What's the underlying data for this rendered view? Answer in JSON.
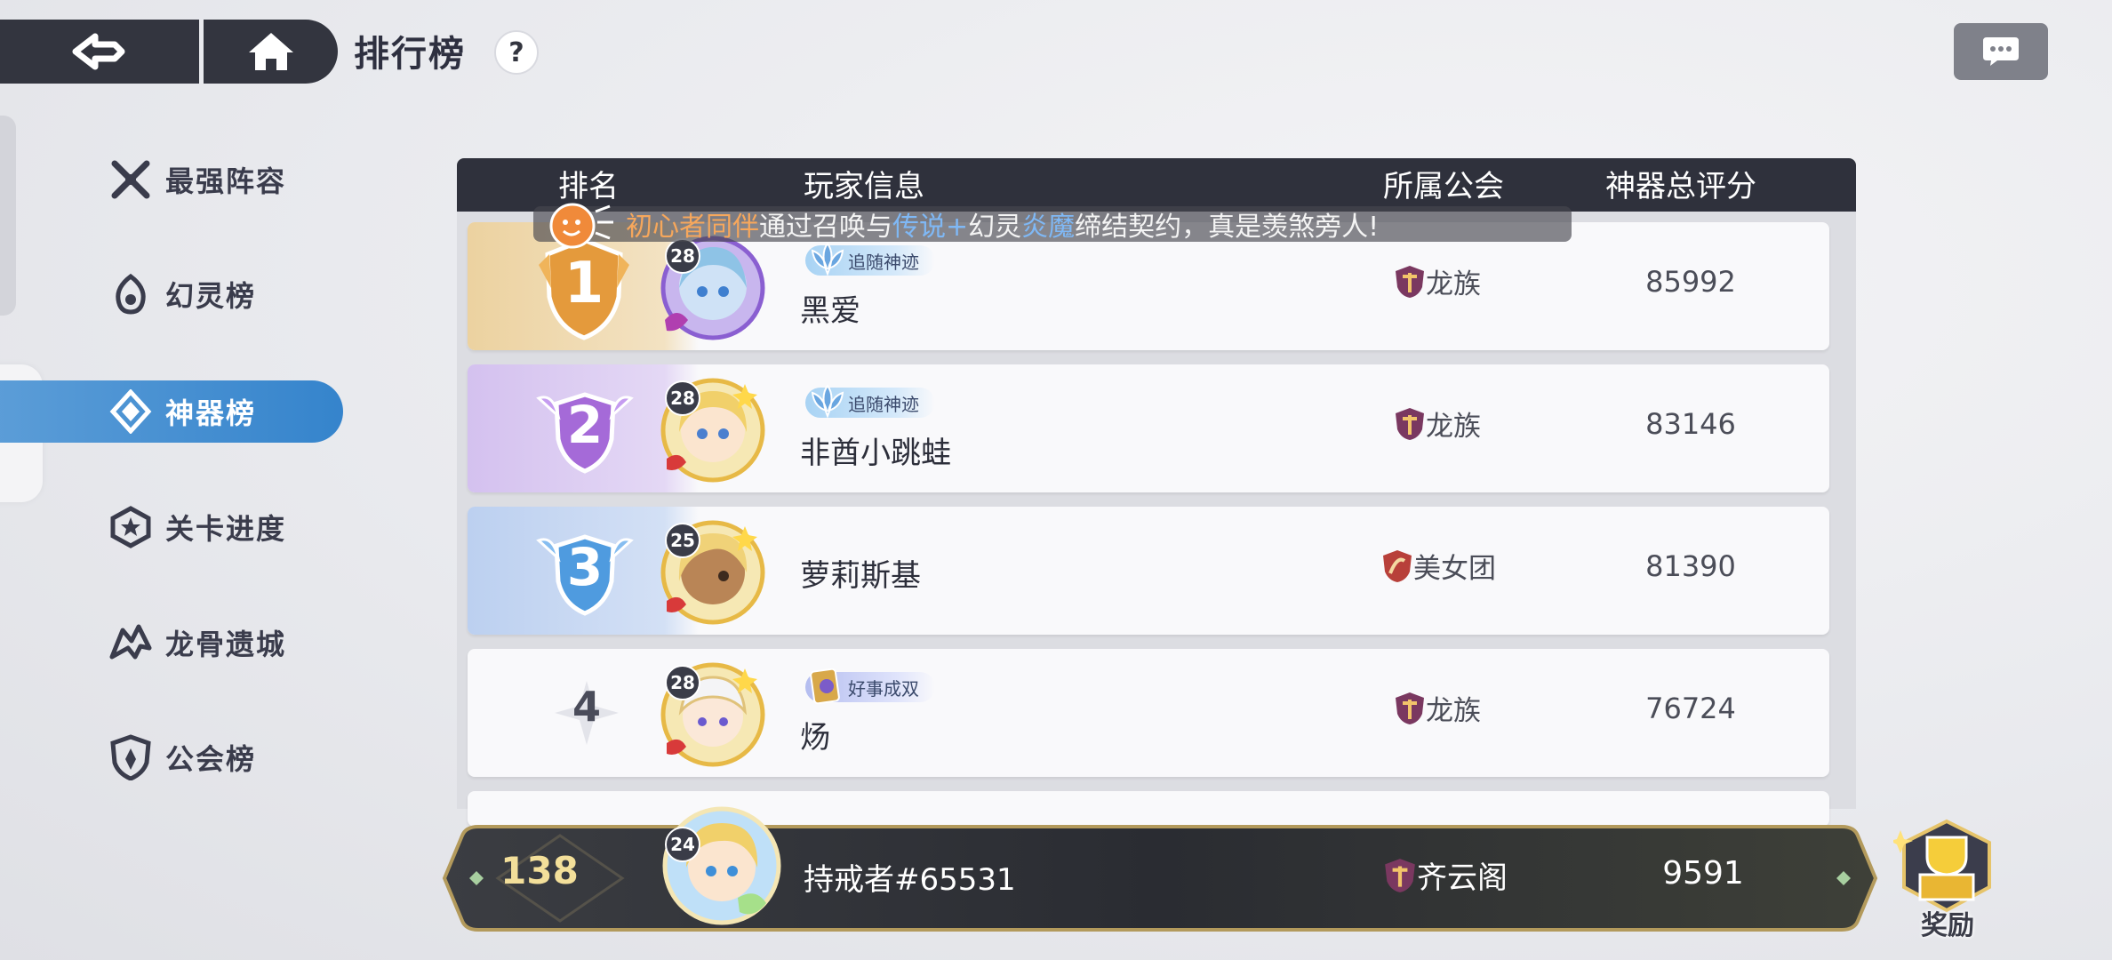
{
  "header": {
    "title": "排行榜",
    "help": "?"
  },
  "sidebar": {
    "items": [
      {
        "label": "最强阵容"
      },
      {
        "label": "幻灵榜"
      },
      {
        "label": "神器榜"
      },
      {
        "label": "关卡进度"
      },
      {
        "label": "龙骨遗城"
      },
      {
        "label": "公会榜"
      }
    ],
    "active_index": 2
  },
  "table": {
    "headers": {
      "rank": "排名",
      "player": "玩家信息",
      "guild": "所属公会",
      "score": "神器总评分"
    },
    "rows": [
      {
        "rank": "1",
        "level": "28",
        "name": "黑爱",
        "title": "追随神迹",
        "guild": "龙族",
        "score": "85992"
      },
      {
        "rank": "2",
        "level": "28",
        "name": "非酋小跳蛙",
        "title": "追随神迹",
        "guild": "龙族",
        "score": "83146"
      },
      {
        "rank": "3",
        "level": "25",
        "name": "萝莉斯基",
        "title": "",
        "guild": "美女团",
        "score": "81390"
      },
      {
        "rank": "4",
        "level": "28",
        "name": "炀",
        "title": "好事成双",
        "guild": "龙族",
        "score": "76724"
      }
    ]
  },
  "broadcast": {
    "p1": "初心者同伴",
    "p2": "通过召唤与",
    "p3": "传说+",
    "p4": "幻灵",
    "p5": "炎魔",
    "p6": "缔结契约，真是羡煞旁人!"
  },
  "self": {
    "rank": "138",
    "level": "24",
    "name": "持戒者#65531",
    "guild": "齐云阁",
    "score": "9591"
  },
  "reward": {
    "label": "奖励"
  },
  "colors": {
    "accent": "#3584cc",
    "gold_bg": "#f0d9a8",
    "purple_bg": "#d7c6f1",
    "blue_bg": "#bfd3f2",
    "dark_bar": "#2f313c"
  }
}
